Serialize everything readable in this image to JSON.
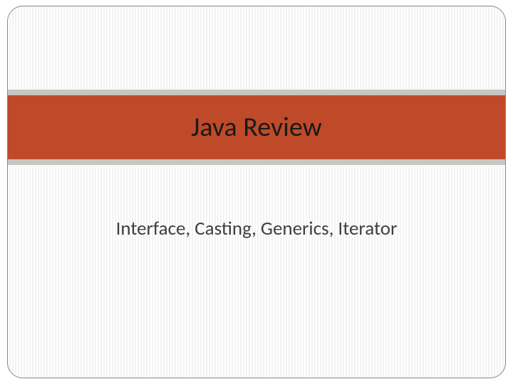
{
  "slide": {
    "title": "Java Review",
    "subtitle": "Interface, Casting, Generics, Iterator"
  }
}
